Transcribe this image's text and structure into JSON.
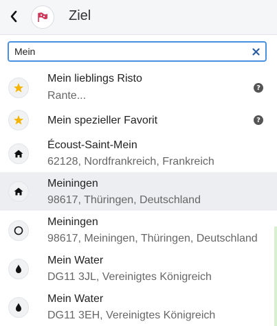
{
  "header": {
    "title": "Ziel",
    "back_icon": "chevron-left-icon",
    "flag_icon": "flag-icon",
    "flag_color": "#d23a5b"
  },
  "search": {
    "value": "Mein",
    "clear_icon": "close-icon",
    "accent": "#4a90e2"
  },
  "results": [
    {
      "icon": "star-icon",
      "name": "Mein lieblings Risto",
      "address": "Rante...",
      "help": "?"
    },
    {
      "icon": "star-icon",
      "name": "Mein spezieller Favorit",
      "address": "",
      "help": "?"
    },
    {
      "icon": "home-icon",
      "name": "Écoust-Saint-Mein",
      "address": "62128, Nordfrankreich, Frankreich"
    },
    {
      "icon": "home-icon",
      "name": "Meiningen",
      "address": "98617, Thüringen, Deutschland",
      "highlighted": true
    },
    {
      "icon": "circle-icon",
      "name": "Meiningen",
      "address": "98617, Meiningen, Thüringen, Deutschland"
    },
    {
      "icon": "water-drop-icon",
      "name": "Mein Water",
      "address": "DG11 3JL, Vereinigtes Königreich"
    },
    {
      "icon": "water-drop-icon",
      "name": "Mein Water",
      "address": "DG11 3EH, Vereinigtes Königreich"
    }
  ],
  "colors": {
    "star": "#f5b400",
    "highlight_bg": "#eceef1"
  }
}
